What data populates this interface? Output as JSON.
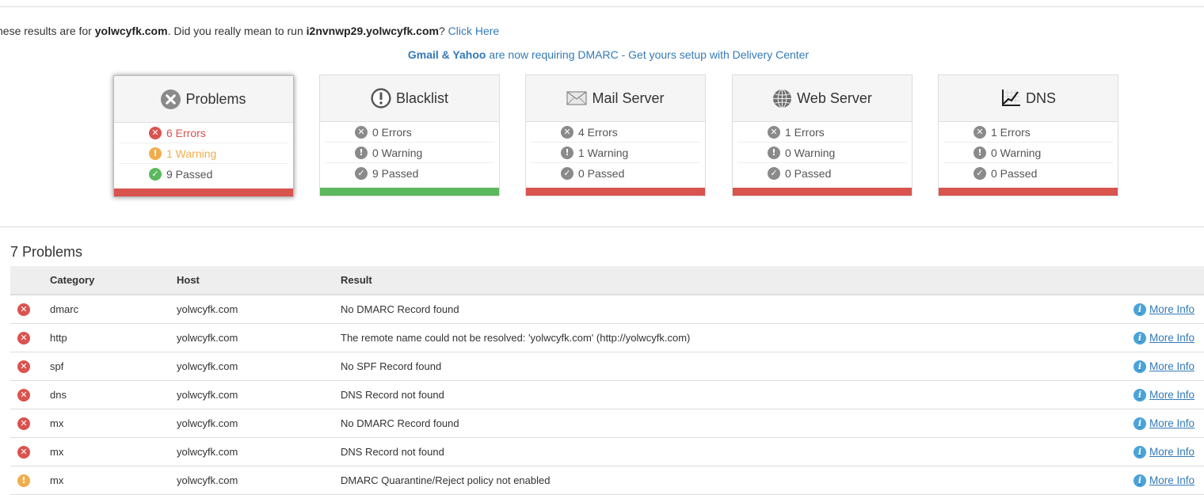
{
  "notice": {
    "prefix": "hese results are for ",
    "domain": "yolwcyfk.com",
    "middle": ". Did you really mean to run ",
    "suggest": "i2nvnwp29.yolwcyfk.com",
    "qmark": "? ",
    "link": "Click Here"
  },
  "promo": {
    "bold": "Gmail & Yahoo",
    "rest": " are now requiring DMARC - Get yours setup with Delivery Center"
  },
  "cards": [
    {
      "title": "Problems",
      "icon": "problems-x-icon",
      "errors": "6 Errors",
      "warnings": "1 Warning",
      "passed": "9 Passed",
      "status": "red"
    },
    {
      "title": "Blacklist",
      "icon": "blacklist-exclamation-icon",
      "errors": "0 Errors",
      "warnings": "0 Warning",
      "passed": "9 Passed",
      "status": "green"
    },
    {
      "title": "Mail Server",
      "icon": "envelope-icon",
      "errors": "4 Errors",
      "warnings": "1 Warning",
      "passed": "0 Passed",
      "status": "red"
    },
    {
      "title": "Web Server",
      "icon": "globe-icon",
      "errors": "1 Errors",
      "warnings": "0 Warning",
      "passed": "0 Passed",
      "status": "red"
    },
    {
      "title": "DNS",
      "icon": "chart-icon",
      "errors": "1 Errors",
      "warnings": "0 Warning",
      "passed": "0 Passed",
      "status": "red"
    }
  ],
  "problems": {
    "title": "7 Problems",
    "columns": [
      "Category",
      "Host",
      "Result"
    ],
    "rows": [
      {
        "status": "error",
        "category": "dmarc",
        "host": "yolwcyfk.com",
        "result": "No DMARC Record found",
        "action": "More Info"
      },
      {
        "status": "error",
        "category": "http",
        "host": "yolwcyfk.com",
        "result": "The remote name could not be resolved: 'yolwcyfk.com' (http://yolwcyfk.com)",
        "action": "More Info"
      },
      {
        "status": "error",
        "category": "spf",
        "host": "yolwcyfk.com",
        "result": "No SPF Record found",
        "action": "More Info"
      },
      {
        "status": "error",
        "category": "dns",
        "host": "yolwcyfk.com",
        "result": "DNS Record not found",
        "action": "More Info"
      },
      {
        "status": "error",
        "category": "mx",
        "host": "yolwcyfk.com",
        "result": "No DMARC Record found",
        "action": "More Info"
      },
      {
        "status": "error",
        "category": "mx",
        "host": "yolwcyfk.com",
        "result": "DNS Record not found",
        "action": "More Info"
      },
      {
        "status": "warning",
        "category": "mx",
        "host": "yolwcyfk.com",
        "result": "DMARC Quarantine/Reject policy not enabled",
        "action": "More Info"
      }
    ]
  },
  "colors": {
    "error": "#d9534f",
    "warning": "#f0ad4e",
    "pass": "#5cb85c",
    "link": "#337ab7"
  }
}
